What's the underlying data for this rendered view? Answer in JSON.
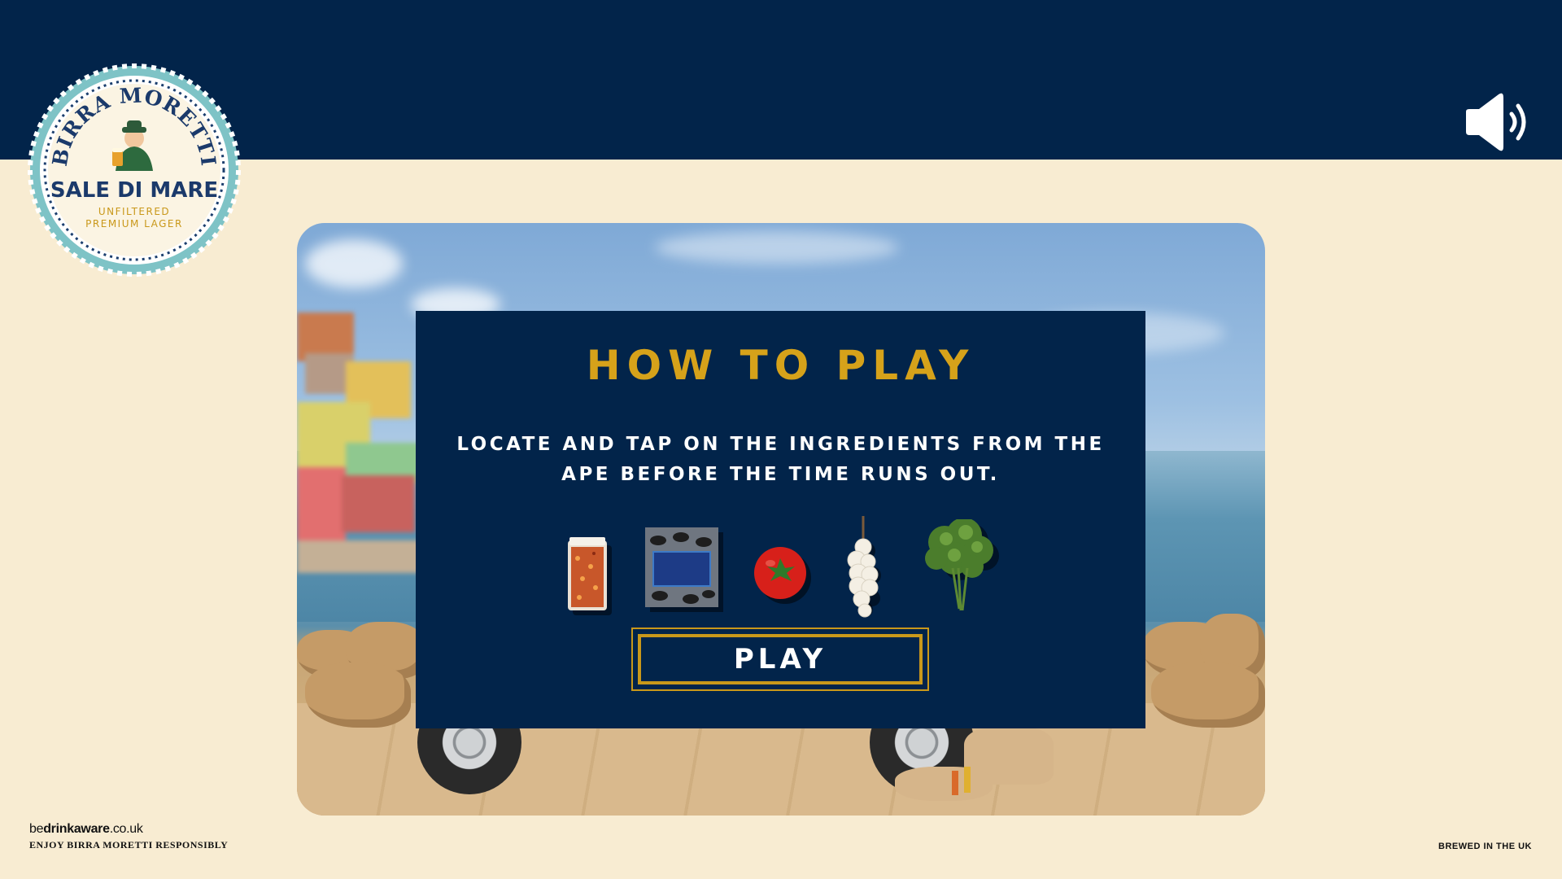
{
  "colors": {
    "navy": "#02244a",
    "cream": "#f8ecd2",
    "gold": "#d6a21a",
    "white": "#ffffff"
  },
  "brand": {
    "name": "BIRRA MORETTI",
    "product": "SALE DI MARE",
    "line1": "UNFILTERED",
    "line2": "PREMIUM LAGER"
  },
  "sound": {
    "icon": "speaker-volume-icon"
  },
  "modal": {
    "title": "HOW TO PLAY",
    "instructions": "LOCATE AND TAP ON THE INGREDIENTS FROM THE APE BEFORE THE TIME RUNS OUT.",
    "ingredients": [
      "chilli-flakes-jar-icon",
      "mussels-bag-icon",
      "tomato-icon",
      "garlic-braid-icon",
      "parsley-icon"
    ],
    "play_label": "PLAY"
  },
  "footer": {
    "drinkaware_prefix": "be",
    "drinkaware_bold": "drinkaware",
    "drinkaware_suffix": ".co.uk",
    "responsibly": "ENJOY BIRRA MORETTI RESPONSIBLY",
    "brewed": "BREWED IN THE UK"
  }
}
